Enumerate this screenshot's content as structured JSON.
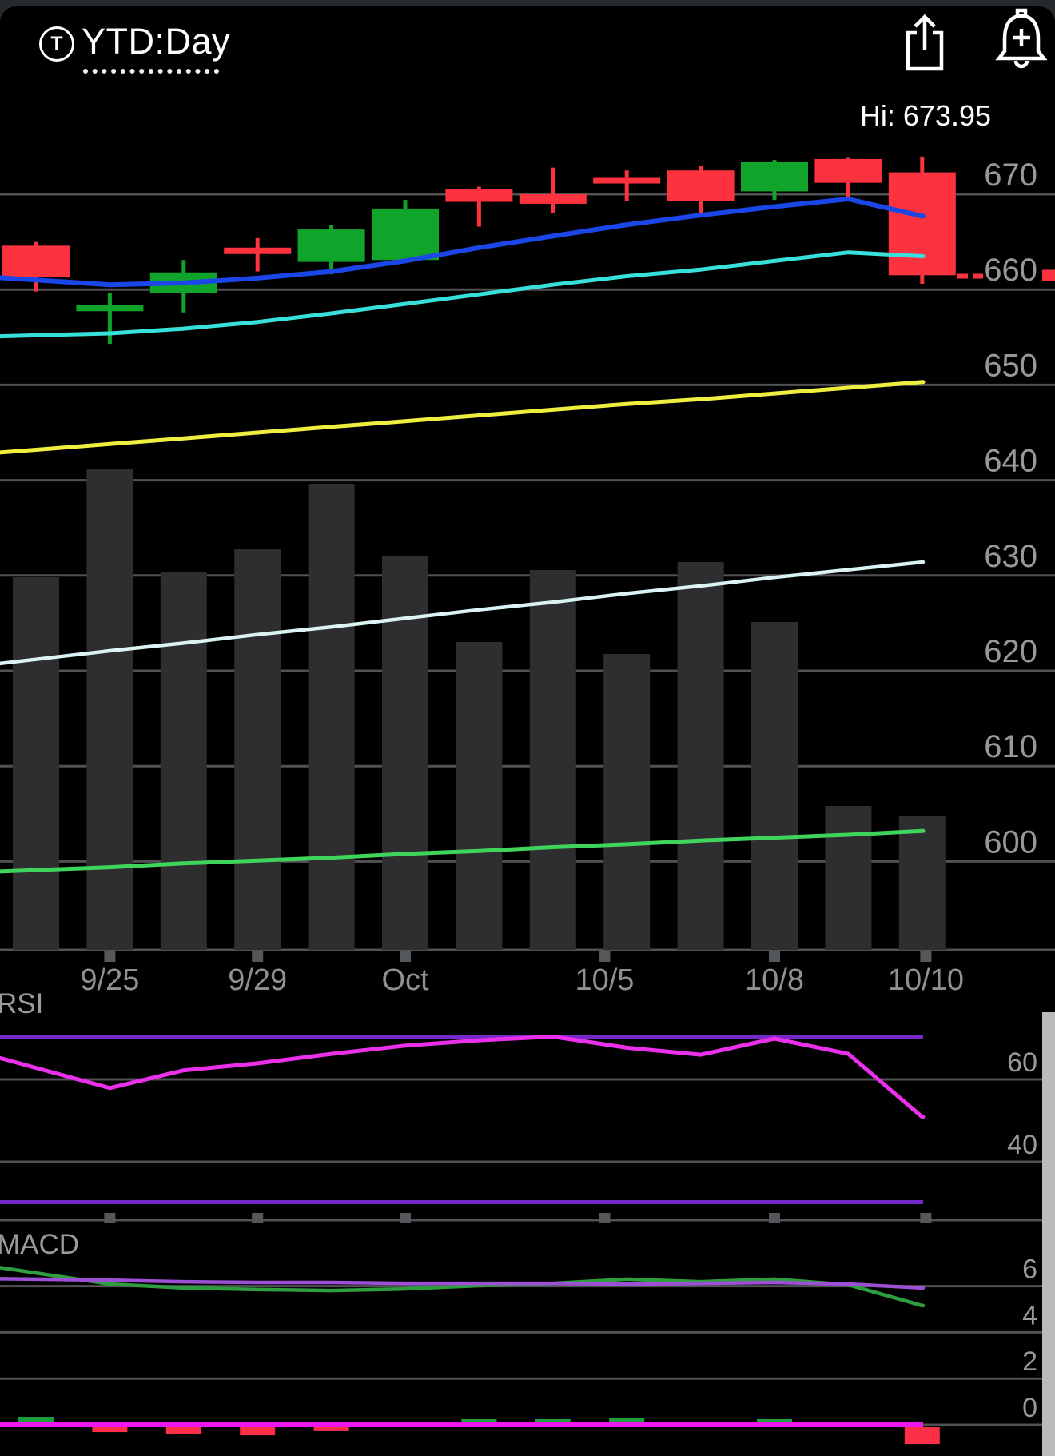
{
  "header": {
    "ticker_symbol": "T",
    "timeframe_label": "YTD:Day"
  },
  "colors": {
    "up": "#11a42b",
    "down": "#fc323e",
    "ma_fast_blue": "#1b46e8",
    "ma_mid_cyan": "#38e0dc",
    "ma_slow_yellow": "#f0ee3e",
    "ma_long_white": "#d9f4f2",
    "ma_longest_green": "#3fd45c",
    "volume_bar": "#2e2e31",
    "grid": "#515154",
    "tick_mark": "#55585a",
    "axis_text": "#98989c",
    "date_text": "#8f8f94",
    "rsi_line": "#ea30ea",
    "rsi_band": "#7529c9",
    "macd_line": "#2f9e3f",
    "macd_signal": "#9d4fd6",
    "macd_zero": "#ee16ee",
    "hist_up": "#1da13c",
    "hist_down": "#fb3048",
    "price_marker": "#fc323e",
    "scroll_strip": "#b9bbbd"
  },
  "chart_data": [
    {
      "type": "candlestick",
      "panel": "price",
      "y_ticks": [
        670,
        660,
        650,
        640,
        630,
        620,
        610,
        600
      ],
      "ylim": [
        598,
        675
      ],
      "grid": true,
      "legend_position": "none",
      "hi_annotation": {
        "text": "Hi: 673.95",
        "value": 673.95
      },
      "last_price": 661.4,
      "candles": [
        {
          "o": 664.6,
          "h": 665.0,
          "l": 659.8,
          "c": 661.3
        },
        {
          "o": 658.0,
          "h": 659.6,
          "l": 654.3,
          "c": 658.4
        },
        {
          "o": 659.6,
          "h": 663.1,
          "l": 657.6,
          "c": 661.8
        },
        {
          "o": 664.4,
          "h": 665.4,
          "l": 661.9,
          "c": 664.0
        },
        {
          "o": 662.9,
          "h": 666.8,
          "l": 661.6,
          "c": 666.3
        },
        {
          "o": 663.1,
          "h": 669.4,
          "l": 662.8,
          "c": 668.5
        },
        {
          "o": 670.5,
          "h": 670.8,
          "l": 666.6,
          "c": 669.2
        },
        {
          "o": 670.0,
          "h": 672.8,
          "l": 668.0,
          "c": 669.0
        },
        {
          "o": 671.8,
          "h": 672.5,
          "l": 669.3,
          "c": 671.4
        },
        {
          "o": 672.5,
          "h": 673.0,
          "l": 667.7,
          "c": 669.3
        },
        {
          "o": 670.3,
          "h": 673.6,
          "l": 669.4,
          "c": 673.4
        },
        {
          "o": 673.7,
          "h": 673.9,
          "l": 669.5,
          "c": 671.2
        },
        {
          "o": 672.3,
          "h": 673.95,
          "l": 660.6,
          "c": 661.5
        }
      ],
      "overlays": [
        {
          "name": "ma-blue",
          "color_key": "ma_fast_blue",
          "width": 6,
          "values": [
            661.0,
            660.5,
            660.7,
            661.2,
            661.9,
            663.0,
            664.4,
            665.6,
            666.8,
            667.8,
            668.7,
            669.5,
            667.7
          ]
        },
        {
          "name": "ma-cyan",
          "color_key": "ma_mid_cyan",
          "width": 5,
          "values": [
            655.2,
            655.4,
            655.9,
            656.6,
            657.5,
            658.5,
            659.5,
            660.5,
            661.4,
            662.1,
            663.0,
            663.9,
            663.5
          ]
        },
        {
          "name": "ma-yellow",
          "color_key": "ma_slow_yellow",
          "width": 5,
          "values": [
            643.2,
            643.8,
            644.4,
            645.0,
            645.6,
            646.2,
            646.8,
            647.4,
            648.0,
            648.5,
            649.1,
            649.7,
            650.3
          ]
        },
        {
          "name": "ma-white",
          "color_key": "ma_long_white",
          "width": 4.5,
          "values": [
            621.2,
            622.1,
            622.9,
            623.8,
            624.6,
            625.5,
            626.4,
            627.2,
            628.1,
            628.9,
            629.8,
            630.6,
            631.4
          ]
        },
        {
          "name": "ma-green",
          "color_key": "ma_longest_green",
          "width": 5,
          "values": [
            599.1,
            599.4,
            599.8,
            600.1,
            600.4,
            600.8,
            601.1,
            601.5,
            601.8,
            602.2,
            602.5,
            602.8,
            603.2
          ]
        }
      ]
    },
    {
      "type": "bar",
      "panel": "volume",
      "note": "no numeric scale shown; heights are relative units",
      "values_rel": [
        466,
        602,
        473,
        501,
        583,
        493,
        385,
        475,
        370,
        485,
        410,
        180,
        168
      ],
      "x_ticks": [
        {
          "label": "9/25",
          "i": 1
        },
        {
          "label": "9/29",
          "i": 3
        },
        {
          "label": "Oct",
          "i": 5
        },
        {
          "label": "10/5",
          "i": 7.7
        },
        {
          "label": "10/8",
          "i": 10
        },
        {
          "label": "10/10",
          "i": 12.05
        }
      ]
    },
    {
      "type": "line",
      "panel": "rsi",
      "label": "RSI",
      "y_ticks": [
        60,
        40
      ],
      "bands": [
        70,
        30
      ],
      "values": [
        62.6,
        57.7,
        62.0,
        63.7,
        66.0,
        68.0,
        69.3,
        70.2,
        67.5,
        65.8,
        69.7,
        66.0,
        50.7
      ]
    },
    {
      "type": "line",
      "panel": "macd",
      "label": "MACD",
      "y_ticks": [
        6,
        4,
        2,
        0
      ],
      "series": [
        {
          "name": "macd",
          "color_key": "macd_line",
          "values": [
            6.57,
            6.09,
            5.92,
            5.85,
            5.81,
            5.88,
            6.02,
            6.12,
            6.3,
            6.19,
            6.3,
            6.06,
            5.16
          ]
        },
        {
          "name": "signal",
          "color_key": "macd_signal",
          "values": [
            6.3,
            6.26,
            6.19,
            6.16,
            6.16,
            6.12,
            6.12,
            6.12,
            6.09,
            6.12,
            6.16,
            6.09,
            5.92
          ]
        }
      ],
      "histogram": [
        0.24,
        -0.21,
        -0.31,
        -0.35,
        -0.17,
        0,
        0.14,
        0.14,
        0.21,
        0,
        0.14,
        0,
        -0.73
      ]
    }
  ]
}
